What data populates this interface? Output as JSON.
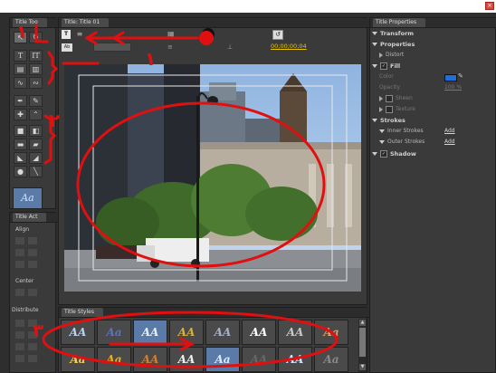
{
  "tools_panel": {
    "title": "Title Too",
    "tools": [
      "selection-tool",
      "rotation-tool",
      "type-tool",
      "vertical-type-tool",
      "area-type-tool",
      "vertical-area-type-tool",
      "path-type-tool",
      "vertical-path-type-tool",
      "pen-tool",
      "delete-anchor-tool",
      "add-anchor-tool",
      "convert-anchor-tool",
      "rectangle-tool",
      "clipped-corner-tool",
      "rounded-rectangle-tool",
      "rounded-corner-tool",
      "wedge-tool",
      "arc-tool",
      "ellipse-tool",
      "line-tool"
    ],
    "style_preview": "Aa"
  },
  "actions_panel": {
    "title": "Title Act",
    "align_label": "Align",
    "center_label": "Center",
    "distribute_label": "Distribute"
  },
  "title_panel": {
    "tab_label": "Title: Title 01",
    "timecode": "00;00;00;04"
  },
  "properties_panel": {
    "tab_label": "Title Properties",
    "sections": {
      "transform": "Transform",
      "properties": "Properties",
      "distort": "Distort",
      "fill": "Fill",
      "color": "Color",
      "opacity": "Opacity",
      "opacity_value": "100 %",
      "sheen": "Sheen",
      "texture": "Texture",
      "strokes": "Strokes",
      "inner_strokes": "Inner Strokes",
      "outer_strokes": "Outer Strokes",
      "add": "Add",
      "shadow": "Shadow"
    }
  },
  "styles_panel": {
    "tab_label": "Title Styles",
    "styles": [
      "AA",
      "Aa",
      "AA",
      "AA",
      "AA",
      "AA",
      "AA",
      "Aa",
      "Aa",
      "Aa",
      "AA",
      "AA",
      "Aa",
      "AA",
      "AA",
      "Aa"
    ]
  },
  "annotations": {
    "arabic_numeral_1": "١",
    "arabic_numeral_2": "٢",
    "arabic_numeral_3": "٣"
  },
  "colors": {
    "annotation": "#e01010",
    "panel": "#3a3a3a",
    "fill_color": "#1f6fd6",
    "timecode": "#e8c400"
  }
}
